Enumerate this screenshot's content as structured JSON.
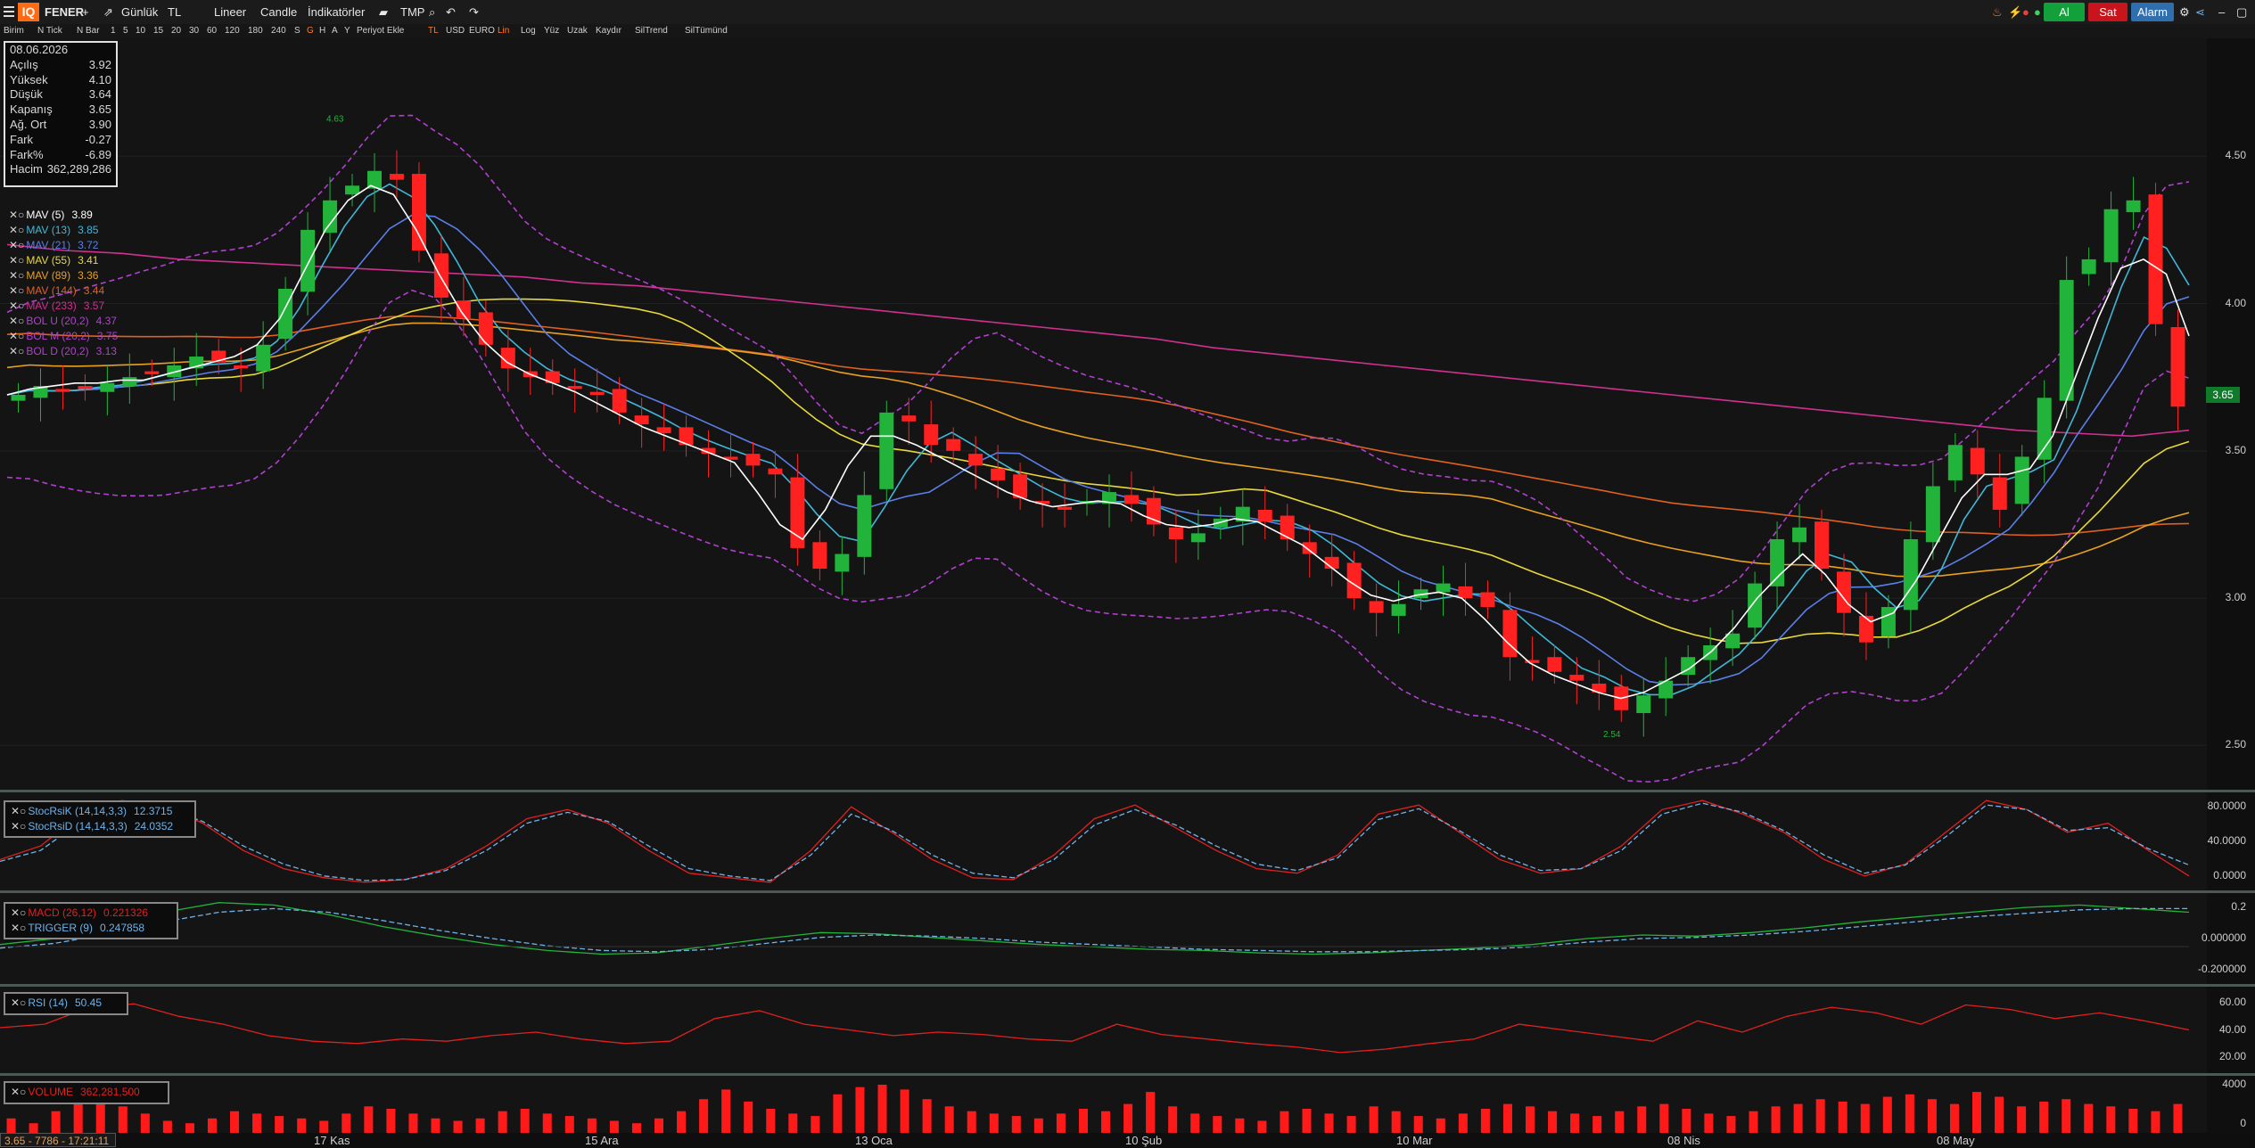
{
  "toolbar": {
    "logo": "IQ",
    "symbol": "FENER",
    "add": "+",
    "period": "Günlük",
    "currency": "TL",
    "scale": "Lineer",
    "chart_type": "Candle",
    "indicators": "İndikatörler",
    "template": "TMP",
    "buy": "Al",
    "sell": "Sat",
    "alarm": "Alarm",
    "buy_color": "#12a03a",
    "sell_color": "#c8141c",
    "alarm_color": "#2f6fb0"
  },
  "toolbar2": {
    "items": [
      "Birim",
      "N Tick",
      "N Bar",
      "1",
      "5",
      "10",
      "15",
      "20",
      "30",
      "60",
      "120",
      "180",
      "240",
      "S",
      "G",
      "H",
      "A",
      "Y",
      "Periyot Ekle",
      "TL",
      "USD",
      "EURO",
      "Lin",
      "Log",
      "Yüz",
      "Uzak",
      "Kaydır",
      "SilTrend",
      "SilTümünd"
    ]
  },
  "ohlc": {
    "date": "08.06.2026",
    "rows": [
      {
        "label": "Açılış",
        "value": "3.92"
      },
      {
        "label": "Yüksek",
        "value": "4.10"
      },
      {
        "label": "Düşük",
        "value": "3.64"
      },
      {
        "label": "Kapanış",
        "value": "3.65"
      },
      {
        "label": "Ağ. Ort",
        "value": "3.90"
      },
      {
        "label": "Fark",
        "value": "-0.27"
      },
      {
        "label": "Fark%",
        "value": "-6.89"
      },
      {
        "label": "Hacim",
        "value": "362,289,286"
      }
    ]
  },
  "indicators": [
    {
      "label": "MAV (5)",
      "value": "3.89",
      "color": "#ffffff"
    },
    {
      "label": "MAV (13)",
      "value": "3.85",
      "color": "#3fb8d8"
    },
    {
      "label": "MAV (21)",
      "value": "3.72",
      "color": "#5a7fe8"
    },
    {
      "label": "MAV (55)",
      "value": "3.41",
      "color": "#e8d83a"
    },
    {
      "label": "MAV (89)",
      "value": "3.36",
      "color": "#e8a020"
    },
    {
      "label": "MAV (144)",
      "value": "3.44",
      "color": "#e06020"
    },
    {
      "label": "MAV (233)",
      "value": "3.57",
      "color": "#d03090"
    },
    {
      "label": "BOL U (20,2)",
      "value": "4.37",
      "color": "#b040d0"
    },
    {
      "label": "BOL M (20,2)",
      "value": "3.75",
      "color": "#b040d0"
    },
    {
      "label": "BOL D (20,2)",
      "value": "3.13",
      "color": "#b040d0"
    }
  ],
  "price_axis": [
    "4.50",
    "4.00",
    "3.50",
    "3.00",
    "2.50"
  ],
  "last_price": "3.65",
  "high_marker": "4.63",
  "low_marker": "2.54",
  "date_axis": [
    "17 Kas",
    "15 Ara",
    "13 Oca",
    "10 Şub",
    "10 Mar",
    "08 Nis",
    "08 May"
  ],
  "stoch": {
    "legend": [
      {
        "label": "StocRsiK (14,14,3,3)",
        "value": "12.3715",
        "color": "#6fb2e8"
      },
      {
        "label": "StocRsiD (14,14,3,3)",
        "value": "24.0352",
        "color": "#6fb2e8"
      }
    ],
    "axis": [
      "80.0000",
      "40.0000",
      "0.0000"
    ]
  },
  "macd": {
    "legend": [
      {
        "label": "MACD (26,12)",
        "value": "0.221326",
        "color": "#e02020"
      },
      {
        "label": "TRIGGER (9)",
        "value": "0.247858",
        "color": "#6fb2e8"
      }
    ],
    "axis": [
      "0.2",
      "0.000000",
      "-0.200000"
    ]
  },
  "rsi": {
    "legend": [
      {
        "label": "RSI (14)",
        "value": "50.45",
        "color": "#6fb2e8"
      }
    ],
    "axis": [
      "60.00",
      "40.00",
      "20.00"
    ]
  },
  "volume": {
    "legend": [
      {
        "label": "VOLUME",
        "value": "362,281,500",
        "color": "#e02020"
      }
    ],
    "axis": [
      "4000",
      "0"
    ]
  },
  "status": "3.65 - 7786 - 17:21:11",
  "chart_data": [
    {
      "type": "candlestick",
      "title": "FENER",
      "ylim": [
        2.35,
        4.9
      ],
      "categories": [
        "17 Kas",
        "15 Ara",
        "13 Oca",
        "10 Şub",
        "10 Mar",
        "08 Nis",
        "08 May"
      ],
      "close": [
        3.69,
        3.72,
        3.7,
        3.71,
        3.73,
        3.75,
        3.76,
        3.79,
        3.82,
        3.8,
        3.78,
        3.86,
        4.05,
        4.25,
        4.35,
        4.4,
        4.45,
        4.42,
        4.18,
        4.02,
        3.95,
        3.86,
        3.78,
        3.75,
        3.73,
        3.71,
        3.69,
        3.63,
        3.59,
        3.56,
        3.52,
        3.49,
        3.47,
        3.45,
        3.42,
        3.17,
        3.1,
        3.15,
        3.35,
        3.63,
        3.6,
        3.52,
        3.5,
        3.45,
        3.4,
        3.34,
        3.32,
        3.3,
        3.33,
        3.36,
        3.32,
        3.25,
        3.2,
        3.22,
        3.27,
        3.31,
        3.26,
        3.2,
        3.15,
        3.1,
        3.0,
        2.95,
        2.98,
        3.03,
        3.05,
        3.0,
        2.97,
        2.8,
        2.78,
        2.75,
        2.72,
        2.68,
        2.62,
        2.67,
        2.72,
        2.8,
        2.84,
        2.88,
        3.05,
        3.2,
        3.24,
        3.1,
        2.95,
        2.85,
        2.97,
        3.2,
        3.38,
        3.52,
        3.42,
        3.3,
        3.48,
        3.68,
        4.08,
        4.15,
        4.32,
        4.35,
        3.93,
        3.65
      ],
      "mav5": [
        3.69,
        3.71,
        3.72,
        3.73,
        3.73,
        3.74,
        3.74,
        3.76,
        3.78,
        3.8,
        3.82,
        3.86,
        3.95,
        4.1,
        4.25,
        4.35,
        4.4,
        4.37,
        4.25,
        4.1,
        3.97,
        3.87,
        3.8,
        3.76,
        3.73,
        3.7,
        3.66,
        3.62,
        3.58,
        3.55,
        3.52,
        3.49,
        3.46,
        3.36,
        3.25,
        3.2,
        3.3,
        3.45,
        3.55,
        3.55,
        3.52,
        3.48,
        3.44,
        3.4,
        3.36,
        3.33,
        3.31,
        3.32,
        3.33,
        3.32,
        3.28,
        3.25,
        3.24,
        3.25,
        3.27,
        3.26,
        3.22,
        3.18,
        3.12,
        3.06,
        3.01,
        2.99,
        3.01,
        3.02,
        3.0,
        2.93,
        2.85,
        2.78,
        2.74,
        2.71,
        2.68,
        2.66,
        2.68,
        2.72,
        2.76,
        2.82,
        2.9,
        3.0,
        3.08,
        3.15,
        3.08,
        2.98,
        2.92,
        2.95,
        3.06,
        3.2,
        3.34,
        3.42,
        3.42,
        3.44,
        3.55,
        3.75,
        3.95,
        4.12,
        4.15,
        4.1,
        3.89
      ],
      "mav233": [
        4.2,
        4.18,
        4.17,
        4.15,
        4.14,
        4.13,
        4.12,
        4.11,
        4.1,
        4.09,
        4.07,
        4.06,
        4.04,
        4.02,
        4.0,
        3.98,
        3.96,
        3.94,
        3.92,
        3.9,
        3.88,
        3.85,
        3.83,
        3.81,
        3.79,
        3.77,
        3.75,
        3.73,
        3.71,
        3.69,
        3.67,
        3.65,
        3.63,
        3.61,
        3.59,
        3.57,
        3.56,
        3.55,
        3.57
      ]
    },
    {
      "type": "line",
      "title": "StocRsi",
      "ylim": [
        0,
        100
      ],
      "series": [
        {
          "name": "StocRsiK (14,14,3,3)",
          "values": [
            30,
            45,
            80,
            95,
            90,
            70,
            40,
            20,
            10,
            5,
            8,
            20,
            45,
            75,
            85,
            70,
            40,
            15,
            10,
            5,
            40,
            88,
            60,
            30,
            10,
            8,
            35,
            75,
            90,
            65,
            40,
            20,
            15,
            35,
            80,
            90,
            60,
            30,
            15,
            20,
            45,
            85,
            95,
            80,
            60,
            30,
            12,
            25,
            60,
            95,
            85,
            60,
            70,
            40,
            12
          ]
        },
        {
          "name": "StocRsiD (14,14,3,3)",
          "values": [
            28,
            40,
            72,
            90,
            88,
            72,
            45,
            25,
            12,
            7,
            8,
            18,
            40,
            70,
            82,
            72,
            45,
            20,
            12,
            7,
            35,
            80,
            62,
            35,
            15,
            10,
            30,
            68,
            85,
            68,
            45,
            25,
            18,
            32,
            74,
            86,
            62,
            35,
            18,
            20,
            40,
            80,
            92,
            82,
            62,
            35,
            15,
            24,
            55,
            90,
            85,
            62,
            65,
            42,
            24
          ]
        }
      ]
    },
    {
      "type": "line",
      "title": "MACD",
      "ylim": [
        -0.35,
        0.35
      ],
      "series": [
        {
          "name": "MACD (26,12)",
          "values": [
            -0.05,
            0.0,
            0.1,
            0.22,
            0.3,
            0.28,
            0.2,
            0.1,
            0.02,
            -0.05,
            -0.1,
            -0.13,
            -0.12,
            -0.06,
            0.0,
            0.05,
            0.04,
            0.01,
            -0.02,
            -0.05,
            -0.07,
            -0.09,
            -0.1,
            -0.12,
            -0.13,
            -0.12,
            -0.1,
            -0.08,
            -0.05,
            0.0,
            0.03,
            0.02,
            0.05,
            0.09,
            0.14,
            0.18,
            0.22,
            0.26,
            0.28,
            0.25,
            0.22
          ]
        },
        {
          "name": "TRIGGER (9)",
          "values": [
            -0.08,
            -0.04,
            0.04,
            0.14,
            0.22,
            0.25,
            0.22,
            0.15,
            0.07,
            0.0,
            -0.06,
            -0.1,
            -0.11,
            -0.09,
            -0.04,
            0.01,
            0.03,
            0.02,
            0.0,
            -0.03,
            -0.05,
            -0.07,
            -0.09,
            -0.1,
            -0.11,
            -0.11,
            -0.1,
            -0.09,
            -0.07,
            -0.03,
            0.0,
            0.01,
            0.03,
            0.06,
            0.1,
            0.14,
            0.18,
            0.21,
            0.24,
            0.25,
            0.25
          ]
        }
      ]
    },
    {
      "type": "line",
      "title": "RSI",
      "ylim": [
        15,
        85
      ],
      "series": [
        {
          "name": "RSI (14)",
          "values": [
            52,
            55,
            70,
            73,
            62,
            55,
            45,
            40,
            38,
            42,
            40,
            45,
            48,
            42,
            38,
            40,
            60,
            67,
            55,
            50,
            45,
            48,
            46,
            42,
            40,
            55,
            46,
            42,
            38,
            35,
            30,
            33,
            38,
            42,
            55,
            50,
            45,
            40,
            58,
            48,
            62,
            70,
            65,
            55,
            72,
            68,
            60,
            65,
            58,
            50
          ]
        }
      ]
    },
    {
      "type": "bar",
      "title": "VOLUME",
      "values": [
        30,
        20,
        45,
        60,
        80,
        55,
        40,
        25,
        20,
        30,
        45,
        40,
        35,
        30,
        25,
        40,
        55,
        50,
        40,
        30,
        25,
        30,
        45,
        50,
        40,
        35,
        30,
        25,
        20,
        30,
        45,
        70,
        90,
        65,
        50,
        40,
        35,
        80,
        95,
        100,
        90,
        70,
        55,
        45,
        40,
        35,
        30,
        40,
        50,
        45,
        60,
        85,
        55,
        40,
        35,
        30,
        25,
        45,
        50,
        40,
        35,
        55,
        45,
        35,
        30,
        40,
        50,
        60,
        55,
        45,
        40,
        35,
        45,
        55,
        60,
        50,
        40,
        35,
        45,
        55,
        60,
        70,
        65,
        60,
        75,
        80,
        70,
        60,
        85,
        75,
        55,
        65,
        70,
        60,
        55,
        50,
        45,
        60
      ]
    }
  ]
}
